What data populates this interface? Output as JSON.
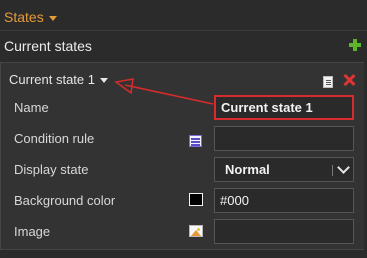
{
  "header": {
    "states_label": "States",
    "current_states_label": "Current states"
  },
  "state": {
    "title": "Current state 1",
    "fields": {
      "name_label": "Name",
      "name_value": "Current state 1",
      "condition_label": "Condition rule",
      "condition_value": "",
      "display_label": "Display state",
      "display_value": "Normal",
      "bgcolor_label": "Background color",
      "bgcolor_value": "#000",
      "image_label": "Image",
      "image_value": ""
    }
  },
  "colors": {
    "accent": "#e69a3a",
    "add_green": "#5fb52a",
    "delete_red": "#e03535",
    "annotation_red": "#d92b2b",
    "background": "#2b2b2b",
    "panel": "#333333",
    "swatch": "#000000"
  },
  "icons": {
    "add": "plus-icon",
    "doc": "document-icon",
    "delete": "close-icon",
    "condition": "list-icon",
    "image": "image-icon",
    "dropdown": "chevron-down-icon"
  }
}
